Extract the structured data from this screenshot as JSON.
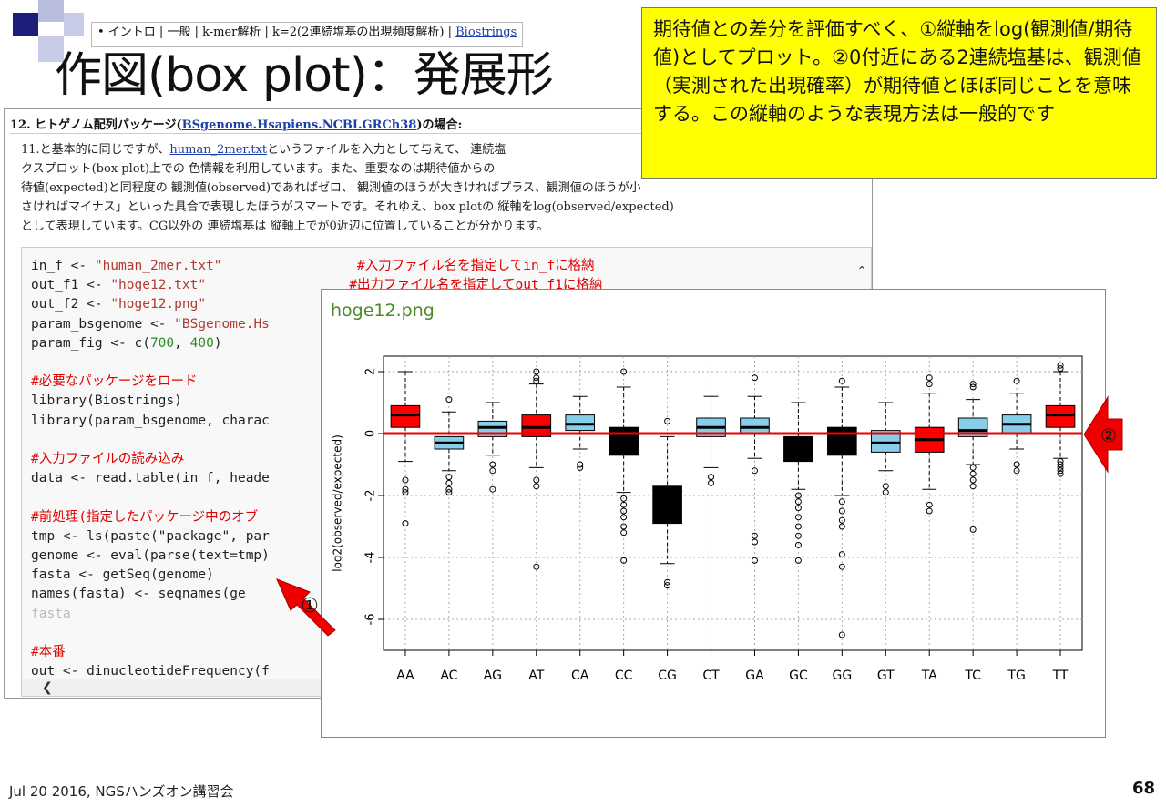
{
  "slide": {
    "breadcrumb": {
      "prefix": "• イントロ | 一般 | k-mer解析 | k=2(2連続塩基の出現頻度解析) | ",
      "link": "Biostrings"
    },
    "title": "作図(box plot)：発展形",
    "callout": "期待値との差分を評価すべく、①縦軸をlog(観測値/期待値)としてプロット。②0付近にある2連続塩基は、観測値（実測された出現確率）が期待値とほぼ同じことを意味する。この縦軸のような表現方法は一般的です",
    "footer": "Jul 20 2016, NGSハンズオン講習会",
    "page_number": "68",
    "marker1": "①",
    "marker2": "②"
  },
  "doc": {
    "section_prefix": "12. ヒトゲノム配列パッケージ(",
    "section_link": "BSgenome.Hsapiens.NCBI.GRCh38",
    "section_suffix": ")の場合:",
    "para_1": "11.と基本的に同じですが、",
    "para_link": "human_2mer.txt",
    "para_2": "というファイルを入力として与えて、 連続塩",
    "para_line2": "クスプロット(box plot)上での 色情報を利用しています。また、重要なのは期待値からの",
    "para_line3": "待値(expected)と同程度の 観測値(observed)であればゼロ、 観測値のほうが大きければプラス、観測値のほうが小",
    "para_line4": "さければマイナス」といった具合で表現したほうがスマートです。それゆえ、box plotの 縦軸をlog(observed/expected)",
    "para_line5": "として表現しています。CG以外の 連続塩基は 縦軸上でが0近辺に位置していることが分かります。",
    "code": [
      {
        "a": "in_f <- ",
        "s": "\"human_2mer.txt\"",
        "pad": "                 ",
        "c": "#入力ファイル名を指定してin_fに格納"
      },
      {
        "a": "out_f1 <- ",
        "s": "\"hoge12.txt\"",
        "pad": "                  ",
        "c": "#出力ファイル名を指定してout_f1に格納"
      },
      {
        "a": "out_f2 <- ",
        "s": "\"hoge12.png\"",
        "pad": "",
        "c": ""
      },
      {
        "a": "param_bsgenome <- ",
        "s": "\"BSgenome.Hs",
        "pad": "",
        "c": ""
      },
      {
        "a": "param_fig <- c(",
        "n": "700",
        "b": ", ",
        "n2": "400",
        "e": ")"
      },
      {
        "blank": true
      },
      {
        "cmt": "#必要なパッケージをロード"
      },
      {
        "a": "library(Biostrings)"
      },
      {
        "a": "library(param_bsgenome, charac"
      },
      {
        "blank": true
      },
      {
        "cmt": "#入力ファイルの読み込み"
      },
      {
        "a": "data <- read.table(in_f, heade"
      },
      {
        "blank": true
      },
      {
        "cmt": "#前処理(指定したパッケージ中のオブ"
      },
      {
        "a": "tmp <- ls(paste(\"package\", par"
      },
      {
        "a": "genome <- eval(parse(text=tmp)"
      },
      {
        "a": "fasta <- getSeq(genome)"
      },
      {
        "a": "names(fasta) <- seqnames(ge"
      },
      {
        "gray": "fasta"
      },
      {
        "blank": true
      },
      {
        "cmt": "#本番"
      },
      {
        "a": "out <- dinucleotideFrequency(f"
      }
    ]
  },
  "image_panel": {
    "filename": "hoge12.png"
  },
  "chart_data": {
    "type": "box",
    "ylabel": "log2(observed/expected)",
    "ylim": [
      -7,
      2.5
    ],
    "yticks": [
      "2",
      "0",
      "-2",
      "-4",
      "-6"
    ],
    "reference_line": 0,
    "grid": "dotted",
    "categories": [
      "AA",
      "AC",
      "AG",
      "AT",
      "CA",
      "CC",
      "CG",
      "CT",
      "GA",
      "GC",
      "GG",
      "GT",
      "TA",
      "TC",
      "TG",
      "TT"
    ],
    "fill_colors": {
      "AA": "#ff0000",
      "AC": "#87ceeb",
      "AG": "#87ceeb",
      "AT": "#ff0000",
      "CA": "#87ceeb",
      "CC": "#000000",
      "CG": "#000000",
      "CT": "#87ceeb",
      "GA": "#87ceeb",
      "GC": "#000000",
      "GG": "#000000",
      "GT": "#87ceeb",
      "TA": "#ff0000",
      "TC": "#87ceeb",
      "TG": "#87ceeb",
      "TT": "#ff0000"
    },
    "boxes": [
      {
        "cat": "AA",
        "q1": 0.2,
        "median": 0.6,
        "q3": 0.9,
        "whisker_low": -0.9,
        "whisker_high": 2.0,
        "outliers": [
          -1.5,
          -1.8,
          -1.9,
          -2.9
        ]
      },
      {
        "cat": "AC",
        "q1": -0.5,
        "median": -0.3,
        "q3": -0.1,
        "whisker_low": -1.2,
        "whisker_high": 0.7,
        "outliers": [
          1.1,
          -1.4,
          -1.6,
          -1.8,
          -1.9
        ]
      },
      {
        "cat": "AG",
        "q1": -0.1,
        "median": 0.2,
        "q3": 0.4,
        "whisker_low": -0.7,
        "whisker_high": 1.0,
        "outliers": [
          -1.0,
          -1.2,
          -1.8
        ]
      },
      {
        "cat": "AT",
        "q1": -0.1,
        "median": 0.2,
        "q3": 0.6,
        "whisker_low": -1.1,
        "whisker_high": 1.6,
        "outliers": [
          2.0,
          1.8,
          1.7,
          -1.5,
          -1.7,
          -4.3
        ]
      },
      {
        "cat": "CA",
        "q1": 0.1,
        "median": 0.3,
        "q3": 0.6,
        "whisker_low": -0.5,
        "whisker_high": 1.2,
        "outliers": [
          -1.0,
          -1.1
        ]
      },
      {
        "cat": "CC",
        "q1": -0.7,
        "median": 0.1,
        "q3": 0.2,
        "whisker_low": -1.9,
        "whisker_high": 1.5,
        "outliers": [
          2.0,
          -2.1,
          -2.3,
          -2.5,
          -2.7,
          -3.0,
          -3.2,
          -4.1
        ]
      },
      {
        "cat": "CG",
        "q1": -2.9,
        "median": -2.4,
        "q3": -1.7,
        "whisker_low": -4.2,
        "whisker_high": -0.1,
        "outliers": [
          0.4,
          -4.8,
          -4.9
        ]
      },
      {
        "cat": "CT",
        "q1": -0.1,
        "median": 0.2,
        "q3": 0.5,
        "whisker_low": -1.1,
        "whisker_high": 1.2,
        "outliers": [
          -1.4,
          -1.6
        ]
      },
      {
        "cat": "GA",
        "q1": 0.0,
        "median": 0.2,
        "q3": 0.5,
        "whisker_low": -0.8,
        "whisker_high": 1.2,
        "outliers": [
          1.8,
          -1.2,
          -3.3,
          -3.5,
          -4.1
        ]
      },
      {
        "cat": "GC",
        "q1": -0.9,
        "median": -0.2,
        "q3": -0.1,
        "whisker_low": -1.8,
        "whisker_high": 1.0,
        "outliers": [
          -2.0,
          -2.2,
          -2.4,
          -2.7,
          -3.0,
          -3.3,
          -3.6,
          -4.1
        ]
      },
      {
        "cat": "GG",
        "q1": -0.7,
        "median": -0.1,
        "q3": 0.2,
        "whisker_low": -2.0,
        "whisker_high": 1.5,
        "outliers": [
          1.7,
          -2.2,
          -2.5,
          -2.8,
          -3.0,
          -3.9,
          -4.3,
          -6.5
        ]
      },
      {
        "cat": "GT",
        "q1": -0.6,
        "median": -0.3,
        "q3": 0.1,
        "whisker_low": -1.2,
        "whisker_high": 1.0,
        "outliers": [
          -1.7,
          -1.9
        ]
      },
      {
        "cat": "TA",
        "q1": -0.6,
        "median": -0.2,
        "q3": 0.2,
        "whisker_low": -1.8,
        "whisker_high": 1.3,
        "outliers": [
          1.8,
          1.6,
          -2.3,
          -2.5
        ]
      },
      {
        "cat": "TC",
        "q1": -0.1,
        "median": 0.1,
        "q3": 0.5,
        "whisker_low": -1.0,
        "whisker_high": 1.1,
        "outliers": [
          1.5,
          1.6,
          -1.1,
          -1.3,
          -1.5,
          -1.7,
          -3.1
        ]
      },
      {
        "cat": "TG",
        "q1": 0.0,
        "median": 0.3,
        "q3": 0.6,
        "whisker_low": -0.5,
        "whisker_high": 1.3,
        "outliers": [
          1.7,
          -1.0,
          -1.2
        ]
      },
      {
        "cat": "TT",
        "q1": 0.2,
        "median": 0.6,
        "q3": 0.9,
        "whisker_low": -0.8,
        "whisker_high": 2.0,
        "outliers": [
          2.2,
          2.1,
          -0.9,
          -1.0,
          -1.1,
          -1.2,
          -1.3
        ]
      }
    ]
  }
}
